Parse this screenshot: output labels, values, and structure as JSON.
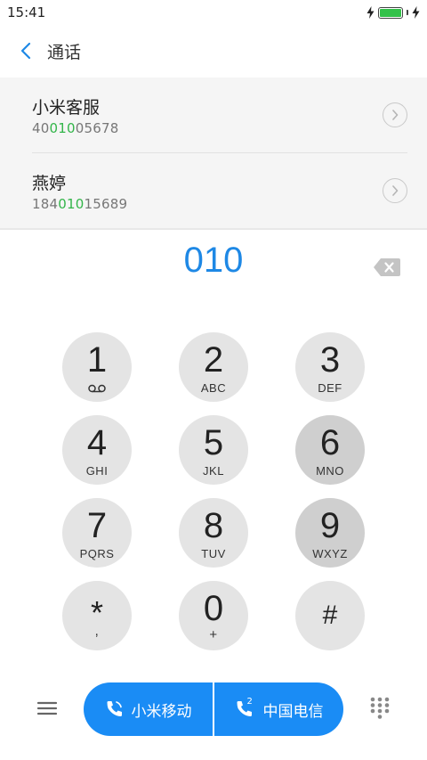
{
  "status_bar": {
    "time": "15:41"
  },
  "header": {
    "title": "通话"
  },
  "suggestions": [
    {
      "name": "小米客服",
      "number_prefix": "40",
      "number_match": "010",
      "number_suffix": "05678"
    },
    {
      "name": "燕婷",
      "number_prefix": "184",
      "number_match": "010",
      "number_suffix": "15689"
    }
  ],
  "dialer": {
    "dialed_number": "010"
  },
  "keypad": [
    {
      "digit": "1",
      "letters": ""
    },
    {
      "digit": "2",
      "letters": "ABC"
    },
    {
      "digit": "3",
      "letters": "DEF"
    },
    {
      "digit": "4",
      "letters": "GHI"
    },
    {
      "digit": "5",
      "letters": "JKL"
    },
    {
      "digit": "6",
      "letters": "MNO"
    },
    {
      "digit": "7",
      "letters": "PQRS"
    },
    {
      "digit": "8",
      "letters": "TUV"
    },
    {
      "digit": "9",
      "letters": "WXYZ"
    },
    {
      "digit": "*",
      "letters": ","
    },
    {
      "digit": "0",
      "letters": "+"
    },
    {
      "digit": "#",
      "letters": ""
    }
  ],
  "call_buttons": {
    "sim1_label": "小米移动",
    "sim2_label": "中国电信",
    "sim2_index": "2"
  },
  "icons": {
    "back": "chevron-left-icon",
    "detail": "chevron-right-circle-icon",
    "backspace": "backspace-icon",
    "voicemail": "voicemail-icon",
    "menu": "menu-icon",
    "phone": "phone-icon",
    "dialpad": "dialpad-icon",
    "charging": "lightning-icon",
    "battery": "battery-icon"
  },
  "colors": {
    "accent": "#1e88e5",
    "call_button": "#1a8cf5",
    "match_highlight": "#33b54a",
    "battery": "#33c24a"
  }
}
